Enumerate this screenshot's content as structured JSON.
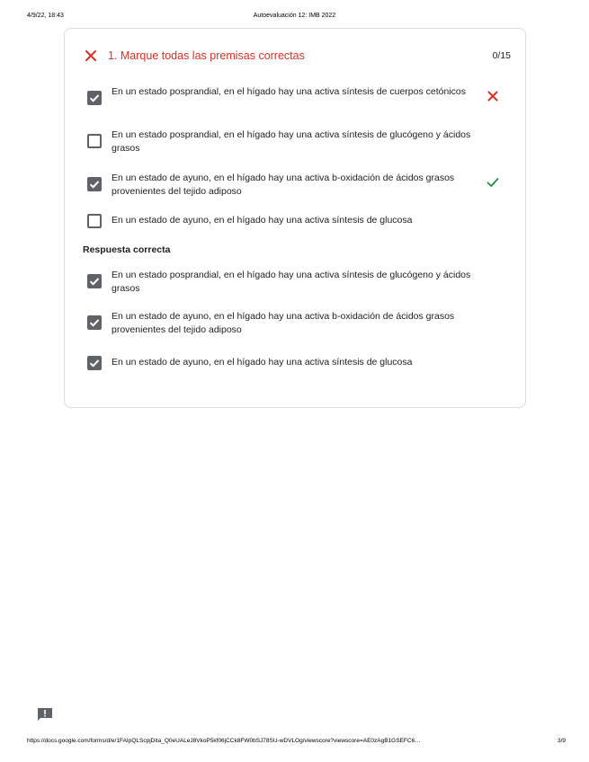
{
  "print_header": {
    "date": "4/9/22, 18:43",
    "title": "Autoevaluación 12: IMB 2022"
  },
  "question": {
    "title": "1. Marque todas las premisas correctas",
    "score": "0/15",
    "status": "incorrect",
    "options": [
      {
        "text": "En un estado posprandial, en el hígado hay una activa síntesis de cuerpos cetónicos",
        "checked": true,
        "mark": "wrong"
      },
      {
        "text": "En un estado posprandial, en el hígado hay una activa síntesis de glucógeno y ácidos grasos",
        "checked": false,
        "mark": "none"
      },
      {
        "text": "En un estado de ayuno, en el hígado hay una activa b-oxidación de ácidos grasos provenientes del tejido adiposo",
        "checked": true,
        "mark": "correct"
      },
      {
        "text": "En un estado de ayuno, en el hígado hay una activa síntesis de glucosa",
        "checked": false,
        "mark": "none"
      }
    ]
  },
  "correct_answer": {
    "label": "Respuesta correcta",
    "options": [
      {
        "text": "En un estado posprandial, en el hígado hay una activa síntesis de glucógeno y ácidos grasos",
        "checked": true
      },
      {
        "text": "En un estado de ayuno, en el hígado hay una activa b-oxidación de ácidos grasos provenientes del tejido adiposo",
        "checked": true
      },
      {
        "text": "En un estado de ayuno, en el hígado hay una activa síntesis de glucosa",
        "checked": true
      }
    ]
  },
  "colors": {
    "error": "#d93025",
    "success": "#1e8e3e",
    "checkbox": "#5f6368"
  },
  "icons": {
    "question_status": "close-icon",
    "feedback": "feedback-icon"
  },
  "print_footer": {
    "url": "https://docs.google.com/forms/d/e/1FAIpQLScpjDita_Q0eUALeJ8VkoP5kf06jCCk8FW0bSJ78SU-wDVLOg/viewscore?viewscore=AE0zAgB1GSEFC6…",
    "page": "3/9"
  }
}
